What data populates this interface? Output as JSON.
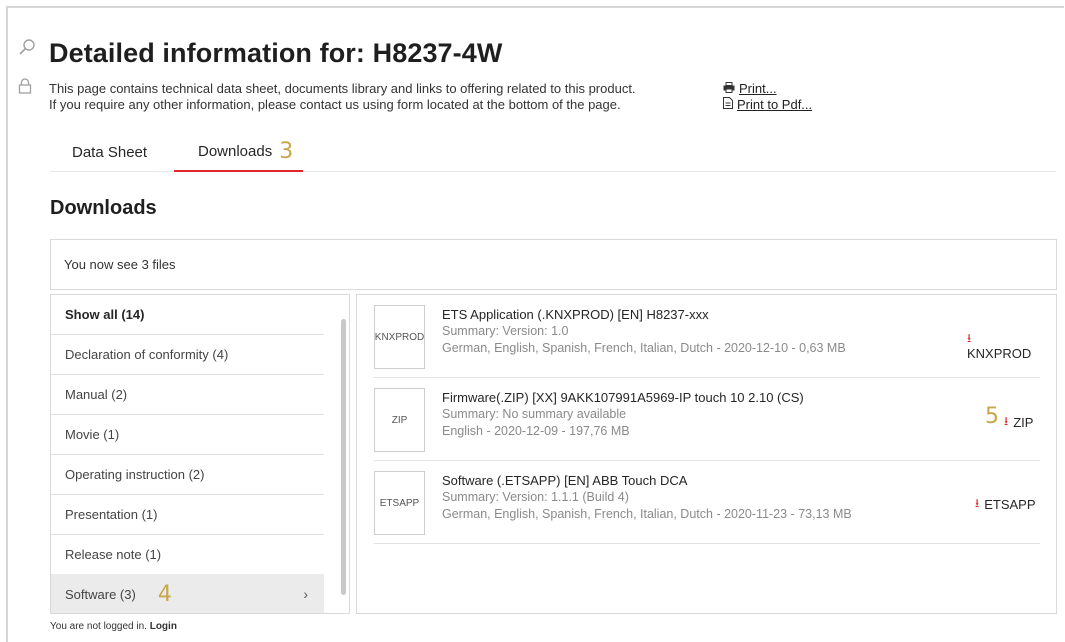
{
  "header": {
    "title": "Detailed information for: H8237-4W",
    "description_line1": "This page contains technical data sheet, documents library and links to offering related to this product.",
    "description_line2": "If you require any other information, please contact us using form located at the bottom of the page.",
    "print_label": "Print...",
    "print_pdf_label": "Print to Pdf..."
  },
  "tabs": [
    {
      "label": "Data Sheet",
      "active": false
    },
    {
      "label": "Downloads",
      "active": true,
      "annotation": "3"
    }
  ],
  "downloads": {
    "section_title": "Downloads",
    "count_text": "You now see 3 files"
  },
  "filters": [
    {
      "label": "Show all (14)"
    },
    {
      "label": "Declaration of conformity (4)"
    },
    {
      "label": "Manual (2)"
    },
    {
      "label": "Movie (1)"
    },
    {
      "label": "Operating instruction (2)"
    },
    {
      "label": "Presentation (1)"
    },
    {
      "label": "Release note (1)"
    },
    {
      "label": "Software (3)",
      "selected": true,
      "annotation": "4",
      "chevron": "›"
    }
  ],
  "files": [
    {
      "thumb": "KNXPROD",
      "title": "ETS Application (.KNXPROD) [EN] H8237-xxx",
      "summary": "Summary: Version: 1.0",
      "details": "German, English, Spanish, French, Italian, Dutch - 2020-12-10 - 0,63 MB",
      "download_label": "KNXPROD"
    },
    {
      "thumb": "ZIP",
      "title": "Firmware(.ZIP) [XX] 9AKK107991A5969-IP touch 10 2.10 (CS)",
      "summary": "Summary: No summary available",
      "details": "English - 2020-12-09 - 197,76 MB",
      "download_label": "ZIP",
      "annotation": "5"
    },
    {
      "thumb": "ETSAPP",
      "title": "Software (.ETSAPP) [EN] ABB Touch DCA",
      "summary": "Summary: Version: 1.1.1 (Build 4)",
      "details": "German, English, Spanish, French, Italian, Dutch - 2020-11-23 - 73,13 MB",
      "download_label": "ETSAPP"
    }
  ],
  "footer": {
    "status": "You are not logged in.",
    "login_label": "Login"
  },
  "icons": {
    "search": "search-icon",
    "lock": "lock-icon",
    "print": "printer-icon",
    "pdf": "pdf-icon",
    "download": "download-icon",
    "chevron": "chevron-right-icon"
  },
  "colors": {
    "accent": "#e0272b",
    "annotation": "#c8a74a"
  }
}
